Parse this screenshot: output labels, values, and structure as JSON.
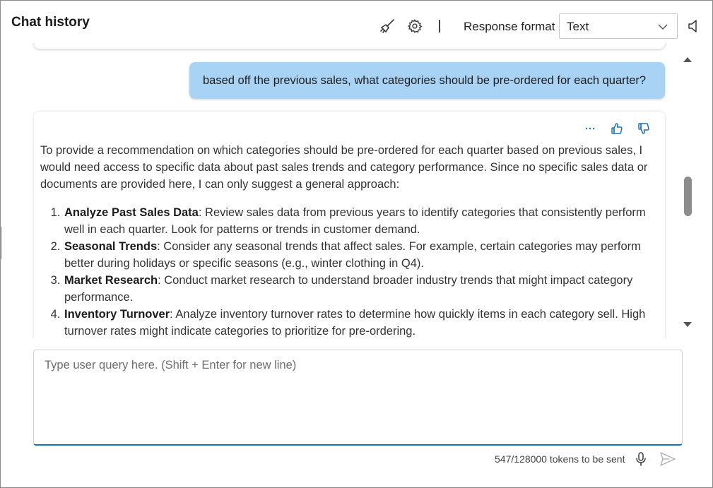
{
  "header": {
    "title": "Chat history",
    "clear_icon": "broom-icon",
    "settings_icon": "gear-icon",
    "response_format_label": "Response format",
    "response_format_value": "Text",
    "speaker_icon": "speaker-icon"
  },
  "chat": {
    "user_message": "based off the previous sales, what categories should be pre-ordered for each quarter?",
    "assistant": {
      "intro": "To provide a recommendation on which categories should be pre-ordered for each quarter based on previous sales, I would need access to specific data about past sales trends and category performance. Since no specific sales data or documents are provided here, I can only suggest a general approach:",
      "items": [
        {
          "title": "Analyze Past Sales Data",
          "text": ": Review sales data from previous years to identify categories that consistently perform well in each quarter. Look for patterns or trends in customer demand."
        },
        {
          "title": "Seasonal Trends",
          "text": ": Consider any seasonal trends that affect sales. For example, certain categories may perform better during holidays or specific seasons (e.g., winter clothing in Q4)."
        },
        {
          "title": "Market Research",
          "text": ": Conduct market research to understand broader industry trends that might impact category performance."
        },
        {
          "title": "Inventory Turnover",
          "text": ": Analyze inventory turnover rates to determine how quickly items in each category sell. High turnover rates might indicate categories to prioritize for pre-ordering."
        }
      ],
      "more_icon": "ellipsis-icon",
      "like_icon": "thumbs-up-icon",
      "dislike_icon": "thumbs-down-icon"
    }
  },
  "input": {
    "placeholder": "Type user query here. (Shift + Enter for new line)",
    "token_status": "547/128000 tokens to be sent"
  },
  "colors": {
    "user_bubble": "#a9d3f5",
    "accent": "#1572c6"
  }
}
